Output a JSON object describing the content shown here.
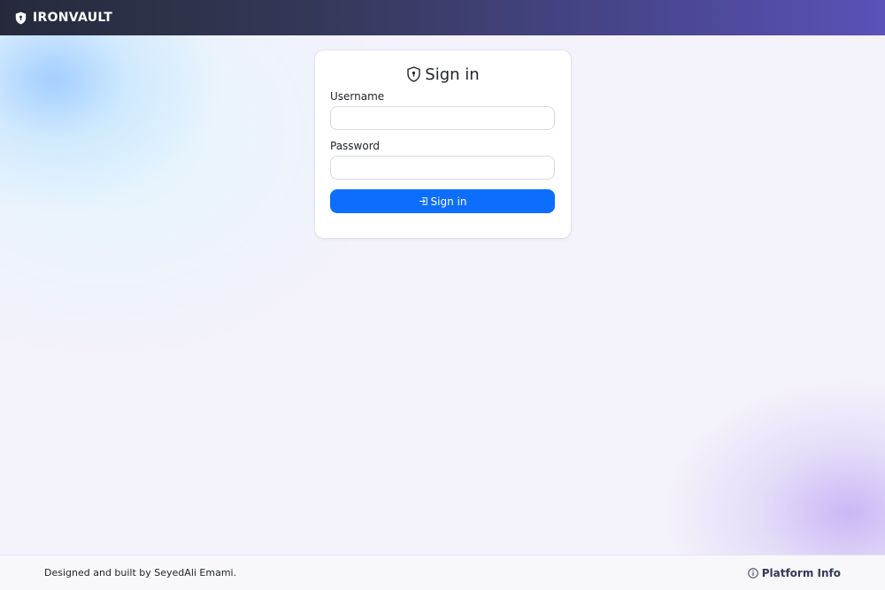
{
  "navbar": {
    "brand_name": "IRONVAULT",
    "brand_icon": "shield-icon"
  },
  "login": {
    "title": "Sign in",
    "title_icon": "shield-lock-icon",
    "username_label": "Username",
    "username_value": "",
    "password_label": "Password",
    "password_value": "",
    "submit_label": "Sign in",
    "submit_icon": "sign-in-icon"
  },
  "footer": {
    "credit": "Designed and built by SeyedAli Emami.",
    "info_label": "Platform Info",
    "info_icon": "info-circle-icon"
  },
  "colors": {
    "accent": "#0d6efd",
    "navbar_start": "#252a3b",
    "navbar_end": "#5a52b8"
  }
}
